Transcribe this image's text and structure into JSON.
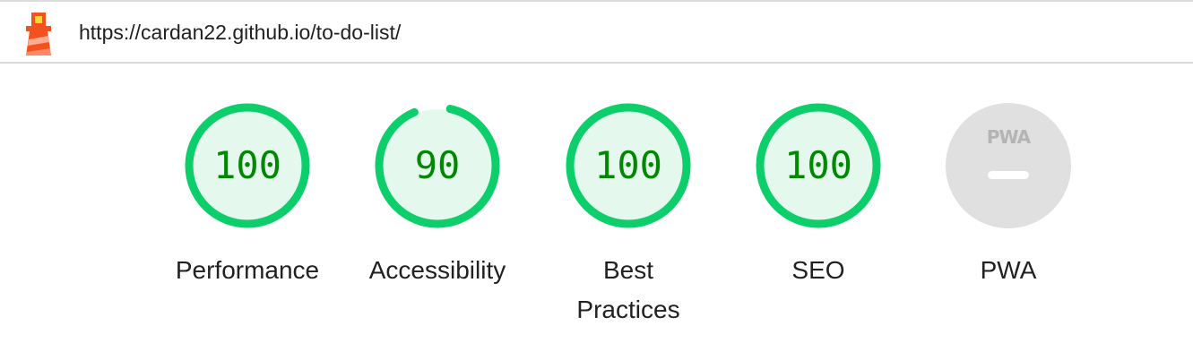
{
  "header": {
    "url": "https://cardan22.github.io/to-do-list/",
    "logo_icon": "lighthouse-icon"
  },
  "colors": {
    "pass_ring": "#0cce6b",
    "pass_fill": "#e5f8ee",
    "pass_text": "#008800",
    "na_fill": "#e0e0e0"
  },
  "gauges": [
    {
      "id": "performance",
      "score": 100,
      "score_text": "100",
      "label": "Performance"
    },
    {
      "id": "accessibility",
      "score": 90,
      "score_text": "90",
      "label": "Accessibility"
    },
    {
      "id": "best-practices",
      "score": 100,
      "score_text": "100",
      "label": "Best Practices"
    },
    {
      "id": "seo",
      "score": 100,
      "score_text": "100",
      "label": "SEO"
    }
  ],
  "pwa": {
    "badge_text": "PWA",
    "label": "PWA",
    "icon": "pwa-icon"
  }
}
